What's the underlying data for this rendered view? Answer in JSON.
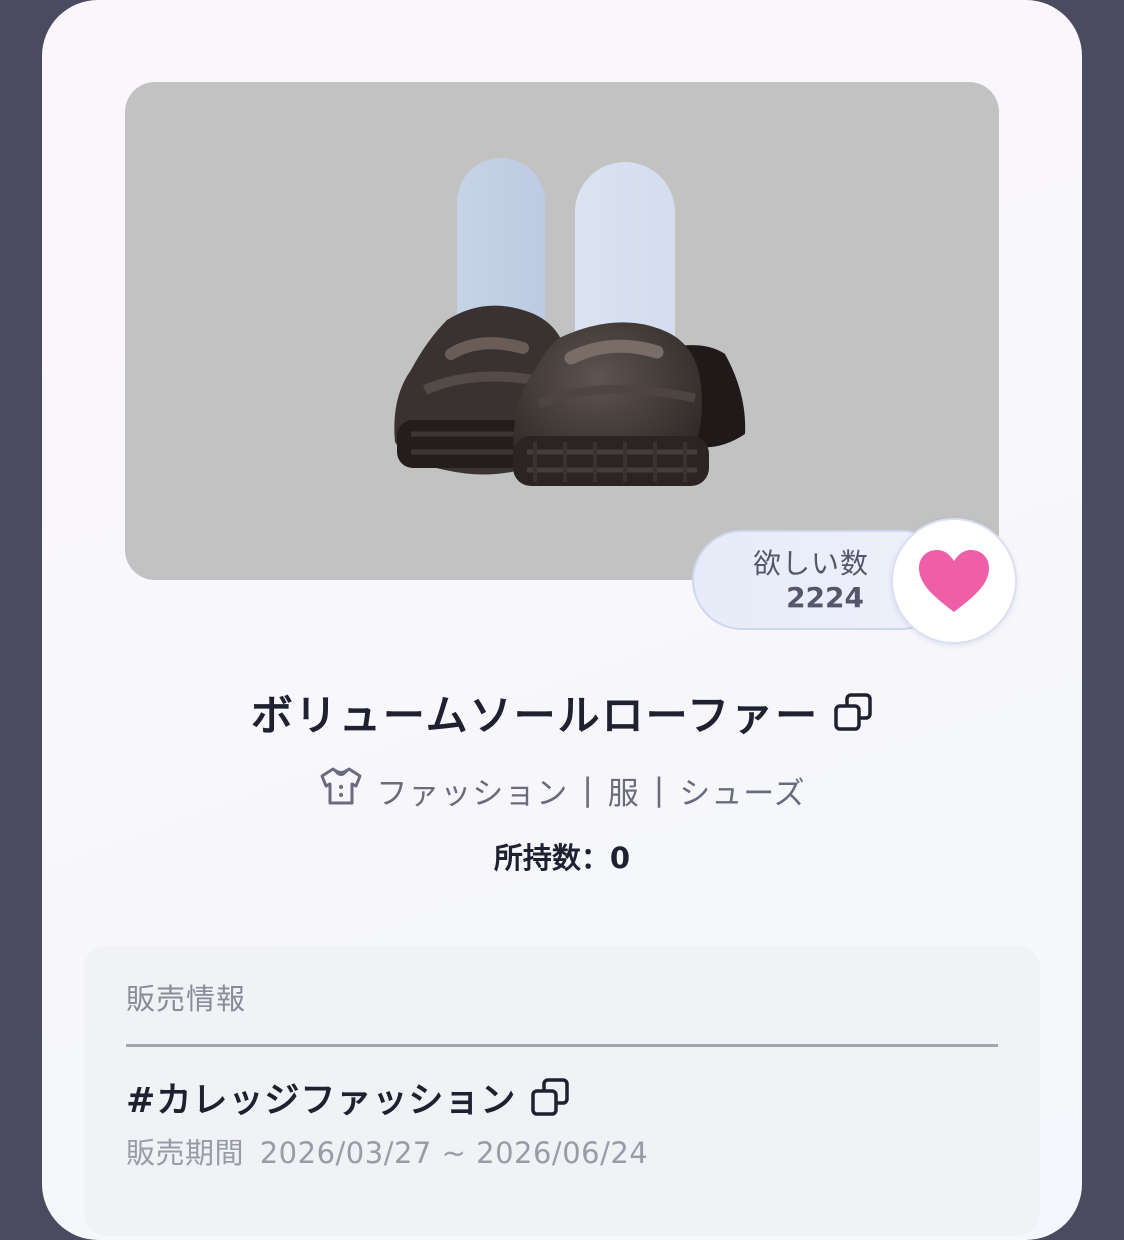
{
  "item": {
    "name": "ボリュームソールローファー",
    "image_icon": "loafer-shoes-with-socks",
    "image_background": "#c2c2c2"
  },
  "wishlist": {
    "label": "欲しい数",
    "count": "2224",
    "icon": "heart-icon",
    "heart_color": "#ef5fa7"
  },
  "category": {
    "icon": "clothing-icon",
    "path": [
      "ファッション",
      "服",
      "シューズ"
    ],
    "separator": "|"
  },
  "owned": {
    "text": "所持数：0"
  },
  "sale_info": {
    "header": "販売情報",
    "event_tag": "#カレッジファッション",
    "period_label": "販売期間",
    "period_value": "2026/03/27 ~ 2026/06/24"
  }
}
